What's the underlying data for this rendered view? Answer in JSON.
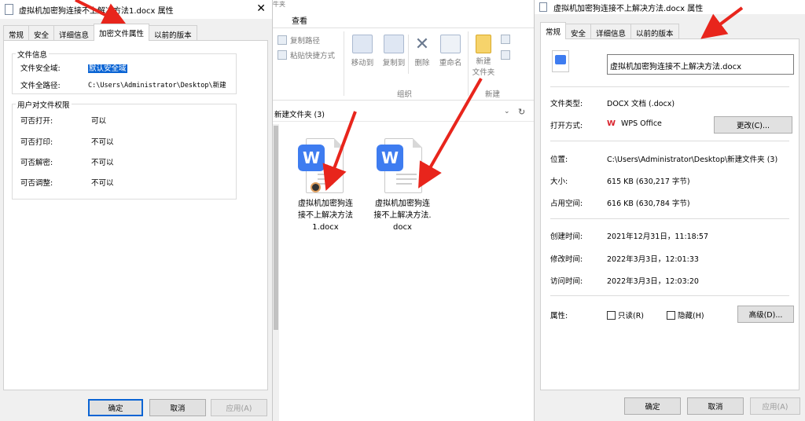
{
  "left_dialog": {
    "title": "虚拟机加密狗连接不上解决方法1.docx 属性",
    "close": "✕",
    "tabs": [
      "常规",
      "安全",
      "详细信息",
      "加密文件属性",
      "以前的版本"
    ],
    "file_info": {
      "group_title": "文件信息",
      "domain_label": "文件安全域:",
      "domain_value": "默认安全域",
      "path_label": "文件全路径:",
      "path_value": "C:\\Users\\Administrator\\Desktop\\新建"
    },
    "permissions": {
      "group_title": "用户对文件权限",
      "rows": [
        {
          "label": "可否打开:",
          "value": "可以"
        },
        {
          "label": "可否打印:",
          "value": "不可以"
        },
        {
          "label": "可否解密:",
          "value": "不可以"
        },
        {
          "label": "可否调整:",
          "value": "不可以"
        }
      ]
    },
    "buttons": {
      "ok": "确定",
      "cancel": "取消",
      "apply": "应用(A)"
    }
  },
  "explorer": {
    "top_strip": "牛夹",
    "ribbon_tab": "查看",
    "copy_path": "复制路径",
    "paste_shortcut": "粘贴快捷方式",
    "move_to": "移动到",
    "copy_to": "复制到",
    "delete": "删除",
    "rename": "重命名",
    "new_folder_line1": "新建",
    "new_folder_line2": "文件夹",
    "group_organize": "组织",
    "group_new": "新建",
    "address": "新建文件夹 (3)",
    "files": [
      {
        "name_lines": [
          "虚拟机加密狗连",
          "接不上解决方法",
          "1.docx"
        ],
        "logo": "W"
      },
      {
        "name_lines": [
          "虚拟机加密狗连",
          "接不上解决方法.",
          "docx"
        ],
        "logo": "W"
      }
    ]
  },
  "right_dialog": {
    "title": "虚拟机加密狗连接不上解决方法.docx 属性",
    "tabs": [
      "常规",
      "安全",
      "详细信息",
      "以前的版本"
    ],
    "filename": "虚拟机加密狗连接不上解决方法.docx",
    "type_label": "文件类型:",
    "type_value": "DOCX 文档 (.docx)",
    "open_label": "打开方式:",
    "open_value": "WPS Office",
    "change_button": "更改(C)...",
    "location_label": "位置:",
    "location_value": "C:\\Users\\Administrator\\Desktop\\新建文件夹 (3)",
    "size_label": "大小:",
    "size_value": "615 KB (630,217 字节)",
    "disk_label": "占用空间:",
    "disk_value": "616 KB (630,784 字节)",
    "created_label": "创建时间:",
    "created_value": "2021年12月31日，11:18:57",
    "modified_label": "修改时间:",
    "modified_value": "2022年3月3日，12:01:33",
    "accessed_label": "访问时间:",
    "accessed_value": "2022年3月3日，12:03:20",
    "attr_label": "属性:",
    "readonly": "只读(R)",
    "hidden": "隐藏(H)",
    "advanced_button": "高级(D)...",
    "buttons": {
      "ok": "确定",
      "cancel": "取消",
      "apply": "应用(A)"
    }
  },
  "colors": {
    "arrow": "#e8251c",
    "selection": "#0a64d4",
    "word_blue": "#3e7cf0"
  }
}
